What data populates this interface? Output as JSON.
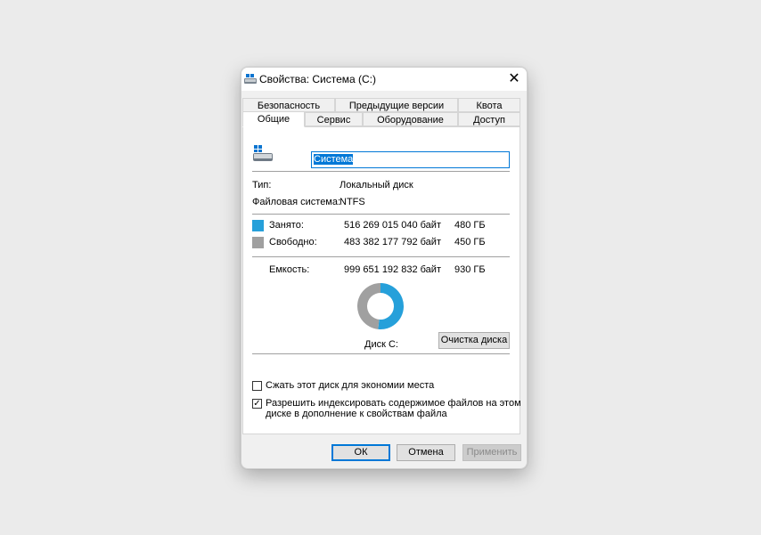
{
  "window": {
    "title": "Свойства: Система (C:)",
    "close_glyph": "✕"
  },
  "tabs_row1": [
    "Безопасность",
    "Предыдущие версии",
    "Квота"
  ],
  "tabs_row2": [
    "Общие",
    "Сервис",
    "Оборудование",
    "Доступ"
  ],
  "active_tab": "Общие",
  "general": {
    "volume_name": "Система",
    "type_label": "Тип:",
    "type_value": "Локальный диск",
    "fs_label": "Файловая система:",
    "fs_value": "NTFS",
    "used_label": "Занято:",
    "used_bytes": "516 269 015 040 байт",
    "used_gb": "480 ГБ",
    "free_label": "Свободно:",
    "free_bytes": "483 382 177 792 байт",
    "free_gb": "450 ГБ",
    "capacity_label": "Емкость:",
    "capacity_bytes": "999 651 192 832 байт",
    "capacity_gb": "930 ГБ",
    "disk_label": "Диск C:",
    "cleanup_button": "Очистка диска",
    "compress_label": "Сжать этот диск для экономии места",
    "compress_checked": false,
    "index_label_line1": "Разрешить индексировать содержимое файлов на этом",
    "index_label_line2": "диске в дополнение к свойствам файла",
    "index_checked": true
  },
  "chart_data": {
    "type": "pie",
    "categories": [
      "Занято",
      "Свободно"
    ],
    "values": [
      516269015040,
      483382177792
    ],
    "colors": [
      "#26a0da",
      "#a0a0a0"
    ],
    "title": "Диск C:"
  },
  "colors": {
    "used": "#26a0da",
    "free": "#a0a0a0",
    "accent": "#0078d7"
  },
  "buttons": {
    "ok": "ОК",
    "cancel": "Отмена",
    "apply": "Применить"
  }
}
